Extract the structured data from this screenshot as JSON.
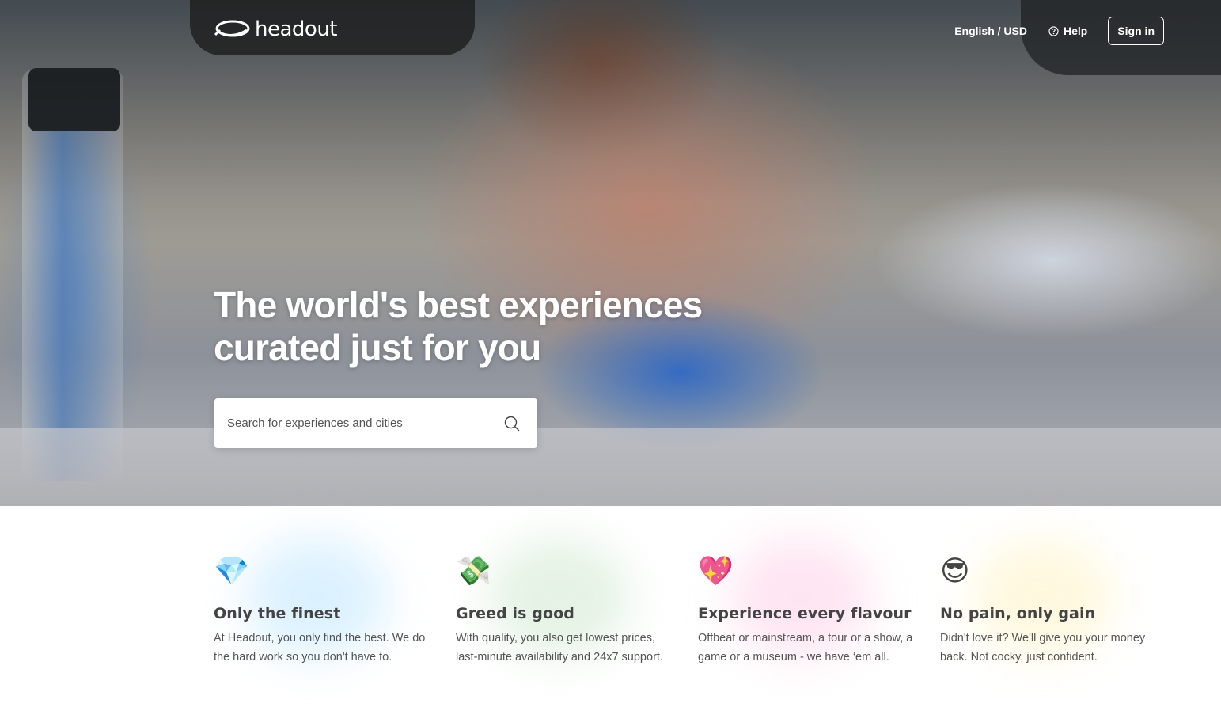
{
  "nav": {
    "logo_text": "headout",
    "language_currency": "English / USD",
    "help_label": "Help",
    "signin_label": "Sign in"
  },
  "hero": {
    "title_line1": "The world's best experiences",
    "title_line2": "curated just for you",
    "search": {
      "placeholder": "Search for experiences and cities"
    }
  },
  "features": [
    {
      "icon": "gem-icon",
      "emoji": "💎",
      "title": "Only the finest",
      "desc_line1": "At Headout, you only find the best. We do",
      "desc_line2": "the hard work so you don't have to.",
      "glow_color": "#bfe6ff"
    },
    {
      "icon": "money-with-wings-icon",
      "emoji": "💸",
      "title": "Greed is good",
      "desc_line1": "With quality, you also get lowest prices,",
      "desc_line2": "last-minute availability and 24x7 support.",
      "glow_color": "#cfe8cf"
    },
    {
      "icon": "sparkling-heart-icon",
      "emoji": "💖",
      "title": "Experience every flavour",
      "desc_line1": "Offbeat or mainstream, a tour or a show, a",
      "desc_line2": "game or a museum - we have ‘em all.",
      "glow_color": "#ffd0e6"
    },
    {
      "icon": "sunglasses-face-icon",
      "emoji": "😎",
      "title": "No pain, only gain",
      "desc_line1": "Didn't love it? We'll give you your money",
      "desc_line2": "back. Not cocky, just confident.",
      "glow_color": "#fff3c4"
    }
  ]
}
